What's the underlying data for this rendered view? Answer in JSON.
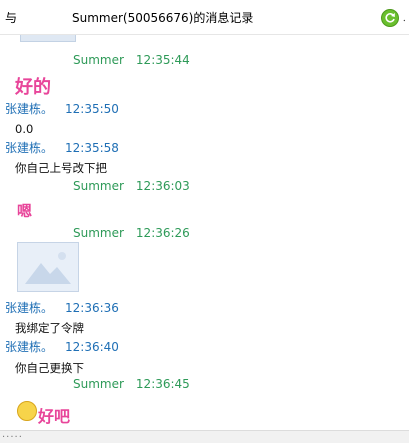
{
  "window": {
    "title_prefix": "与",
    "title": "Summer(50056676)的消息记录"
  },
  "messages": {
    "m1": {
      "sender": "Summer",
      "time": "12:35:44",
      "text": "好的"
    },
    "m2": {
      "sender": "张建栋。",
      "time": "12:35:50",
      "text": "0.0"
    },
    "m3": {
      "sender": "张建栋。",
      "time": "12:35:58",
      "text": "你自己上号改下把"
    },
    "m4": {
      "sender": "Summer",
      "time": "12:36:03",
      "text": "嗯"
    },
    "m5": {
      "sender": "Summer",
      "time": "12:36:26"
    },
    "m6": {
      "sender": "张建栋。",
      "time": "12:36:36",
      "text": "我绑定了令牌"
    },
    "m7": {
      "sender": "张建栋。",
      "time": "12:36:40",
      "text": "你自己更换下"
    },
    "m8": {
      "sender": "Summer",
      "time": "12:36:45",
      "text": "好吧"
    }
  },
  "status_bar": {
    "text": "....."
  },
  "colors": {
    "summer_meta": "#2e9a58",
    "zhang_meta": "#1f6fb5",
    "pink_text": "#e8459a"
  },
  "icons": {
    "refresh": "refresh-icon",
    "image": "image-icon",
    "emoji": "emoji-icon"
  }
}
